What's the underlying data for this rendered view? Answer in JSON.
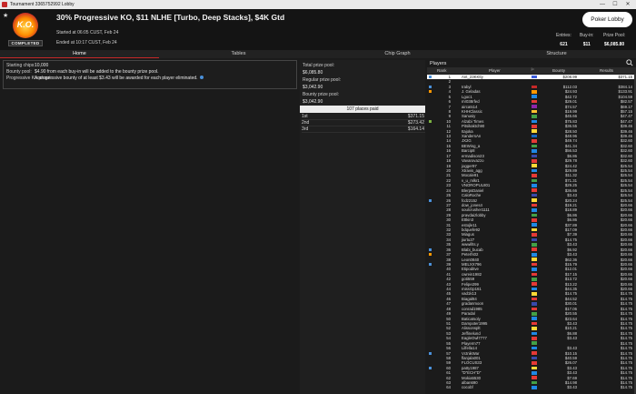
{
  "window": {
    "title": "Tournament 3365752992 Lobby",
    "controls": [
      "—",
      "☐",
      "✕"
    ]
  },
  "header": {
    "logo_text": "K.O.",
    "logo_badge": "COMPLETED",
    "tournament_name": "30% Progressive KO, $11 NLHE [Turbo, Deep Stacks], $4K Gtd",
    "started": "Started at 06:05 CUST, Feb 24",
    "ended": "Ended at 10:17 CUST, Feb 24",
    "lobby_button": "Poker Lobby",
    "entries_label": "Entries:",
    "entries_value": "621",
    "buyin_label": "Buy-in:",
    "buyin_value": "$11",
    "prizepool_label": "Prize Pool:",
    "prizepool_value": "$6,085.80"
  },
  "tabs": [
    {
      "label": "Home",
      "active": true
    },
    {
      "label": "Tables",
      "active": false
    },
    {
      "label": "Chip Graph",
      "active": false
    },
    {
      "label": "Structure",
      "active": false
    }
  ],
  "info": {
    "starting_chips_label": "Starting chips:",
    "starting_chips_value": "10,000",
    "bounty_pool_label": "Bounty pool:",
    "bounty_pool_value": "$4.90 from each buy-in will be added to the bounty prize pool.",
    "progressive_label": "Progressive Knockout:",
    "progressive_value": "A progressive bounty of at least $3.43 will be awarded for each player eliminated."
  },
  "pools": {
    "total_label": "Total prize pool:",
    "total_value": "$6,085.80",
    "regular_label": "Regular prize pool:",
    "regular_value": "$3,042.90",
    "bounty_label": "Bounty prize pool:",
    "bounty_value": "$3,042.90",
    "places_header": "107 places paid",
    "places": [
      {
        "place": "1st",
        "amount": "$371.15"
      },
      {
        "place": "2nd",
        "amount": "$273.42"
      },
      {
        "place": "3rd",
        "amount": "$164.14"
      }
    ]
  },
  "players": {
    "title": "Players",
    "columns": {
      "rank": "Rank",
      "player": "Player",
      "bounty": "Bounty",
      "results": "Results"
    },
    "rows": [
      {
        "rank": "1",
        "name": "Ant_23KKtty",
        "bounty": "$208.99",
        "result": "$371.15",
        "selected": true,
        "flag": "#3b5bdb",
        "mark": "#4a90d9"
      },
      {
        "rank": "2",
        "name": "",
        "bounty": "",
        "result": "",
        "flag": "",
        "mark": ""
      },
      {
        "rank": "3",
        "name": "Irabyl",
        "bounty": "$112.03",
        "result": "$384.14",
        "flag": "#c62828",
        "mark": "#4a90d9"
      },
      {
        "rank": "4",
        "name": "J. Geladas",
        "bounty": "$24.93",
        "result": "$133.91",
        "flag": "#ff9800",
        "mark": "#ff9800"
      },
      {
        "rank": "5",
        "name": "Lgoc1",
        "bounty": "$42.72",
        "result": "$104.59",
        "flag": "#1e88e5",
        "mark": ""
      },
      {
        "rank": "6",
        "name": "mr038rfed",
        "bounty": "$29.01",
        "result": "$82.57",
        "flag": "#e53935",
        "mark": ""
      },
      {
        "rank": "7",
        "name": "aircats14",
        "bounty": "$74.57",
        "result": "$69.17",
        "flag": "#8e24aa",
        "mark": ""
      },
      {
        "rank": "8",
        "name": "KHHClassic",
        "bounty": "$19.99",
        "result": "$57.15",
        "flag": "#fbc02d",
        "mark": ""
      },
      {
        "rank": "9",
        "name": "Sanusiy",
        "bounty": "$45.66",
        "result": "$47.47",
        "flag": "#43a047",
        "mark": ""
      },
      {
        "rank": "10",
        "name": "Alzabi Times",
        "bounty": "$75.83",
        "result": "$47.47",
        "flag": "#1e88e5",
        "mark": "#7cb342"
      },
      {
        "rank": "11",
        "name": "Pitsikaktch90",
        "bounty": "$36.55",
        "result": "$39.46",
        "flag": "#e53935",
        "mark": ""
      },
      {
        "rank": "12",
        "name": "Itajoka",
        "bounty": "$28.50",
        "result": "$39.46",
        "flag": "#fdd835",
        "mark": ""
      },
      {
        "rank": "13",
        "name": "XandersAn",
        "bounty": "$48.96",
        "result": "$39.46",
        "flag": "#1565c0",
        "mark": ""
      },
      {
        "rank": "14",
        "name": "JX2G",
        "bounty": "$49.74",
        "result": "$32.60",
        "flag": "#e53935",
        "mark": ""
      },
      {
        "rank": "15",
        "name": "BEWing_a",
        "bounty": "$41.34",
        "result": "$32.60",
        "flag": "#43a047",
        "mark": ""
      },
      {
        "rank": "16",
        "name": "Barcip8",
        "bounty": "$56.53",
        "result": "$32.60",
        "flag": "#1e88e5",
        "mark": ""
      },
      {
        "rank": "17",
        "name": "ermadison23",
        "bounty": "$6.86",
        "result": "$32.60",
        "flag": "#3949ab",
        "mark": ""
      },
      {
        "rank": "18",
        "name": "Vavarovazzo",
        "bounty": "$29.78",
        "result": "$32.60",
        "flag": "#e53935",
        "mark": ""
      },
      {
        "rank": "19",
        "name": "jogger97",
        "bounty": "$24.42",
        "result": "$25.54",
        "flag": "#fdd835",
        "mark": ""
      },
      {
        "rank": "20",
        "name": "Xtravis_agg",
        "bounty": "$29.89",
        "result": "$25.54",
        "flag": "#1e88e5",
        "mark": ""
      },
      {
        "rank": "21",
        "name": "Mocale91",
        "bounty": "$11.32",
        "result": "$25.54",
        "flag": "#e53935",
        "mark": ""
      },
      {
        "rank": "22",
        "name": "v_u_mlkr1",
        "bounty": "$71.31",
        "result": "$25.54",
        "flag": "#43a047",
        "mark": ""
      },
      {
        "rank": "23",
        "name": "VNOROPUL801",
        "bounty": "$29.25",
        "result": "$25.54",
        "flag": "#1e88e5",
        "mark": ""
      },
      {
        "rank": "24",
        "name": "BlerpsDaniel",
        "bounty": "$36.66",
        "result": "$25.54",
        "flag": "#e53935",
        "mark": ""
      },
      {
        "rank": "25",
        "name": "CaloRoche",
        "bounty": "$3.43",
        "result": "$25.54",
        "flag": "#3949ab",
        "mark": ""
      },
      {
        "rank": "26",
        "name": "fcdz215z",
        "bounty": "$20.24",
        "result": "$25.54",
        "flag": "#fdd835",
        "mark": "#4a90d9"
      },
      {
        "rank": "27",
        "name": "dow_jones4",
        "bounty": "$19.21",
        "result": "$20.66",
        "flag": "#e53935",
        "mark": ""
      },
      {
        "rank": "28",
        "name": "soulcrusher1111",
        "bounty": "$18.89",
        "result": "$20.66",
        "flag": "#1e88e5",
        "mark": ""
      },
      {
        "rank": "29",
        "name": "pravdaizlobby",
        "bounty": "$6.86",
        "result": "$20.66",
        "flag": "#43a047",
        "mark": ""
      },
      {
        "rank": "30",
        "name": "Ettkin3",
        "bounty": "$6.86",
        "result": "$20.66",
        "flag": "#e53935",
        "mark": ""
      },
      {
        "rank": "31",
        "name": "estojle11",
        "bounty": "$37.89",
        "result": "$20.66",
        "flag": "#1e88e5",
        "mark": ""
      },
      {
        "rank": "32",
        "name": "bdquefe92",
        "bounty": "$17.09",
        "result": "$20.66",
        "flag": "#fdd835",
        "mark": ""
      },
      {
        "rank": "33",
        "name": "Miagus",
        "bounty": "$7.39",
        "result": "$20.66",
        "flag": "#e53935",
        "mark": ""
      },
      {
        "rank": "34",
        "name": "jiurtu27",
        "bounty": "$14.75",
        "result": "$20.66",
        "flag": "#3949ab",
        "mark": ""
      },
      {
        "rank": "35",
        "name": "wwwillts.y",
        "bounty": "$3.43",
        "result": "$20.66",
        "flag": "#43a047",
        "mark": ""
      },
      {
        "rank": "36",
        "name": "Blabi_bucab",
        "bounty": "$6.92",
        "result": "$20.66",
        "flag": "#e53935",
        "mark": "#4a90d9"
      },
      {
        "rank": "37",
        "name": "Peterfs02",
        "bounty": "$3.43",
        "result": "$20.66",
        "flag": "#1e88e5",
        "mark": "#ff9800"
      },
      {
        "rank": "38",
        "name": "Leon0840",
        "bounty": "$62.36",
        "result": "$20.66",
        "flag": "#fdd835",
        "mark": ""
      },
      {
        "rank": "39",
        "name": "MELXX796",
        "bounty": "$15.79",
        "result": "$20.66",
        "flag": "#e53935",
        "mark": "#4a90d9"
      },
      {
        "rank": "40",
        "name": "Etipoditve",
        "bounty": "$12.01",
        "result": "$20.66",
        "flag": "#1e88e5",
        "mark": ""
      },
      {
        "rank": "41",
        "name": "cwrein1982",
        "bounty": "$17.15",
        "result": "$20.66",
        "flag": "#e53935",
        "mark": ""
      },
      {
        "rank": "42",
        "name": "goti559",
        "bounty": "$13.72",
        "result": "$20.66",
        "flag": "#43a047",
        "mark": ""
      },
      {
        "rank": "43",
        "name": "Felipe299",
        "bounty": "$13.22",
        "result": "$20.66",
        "flag": "#e53935",
        "mark": ""
      },
      {
        "rank": "44",
        "name": "missGp161",
        "bounty": "$44.35",
        "result": "$20.66",
        "flag": "#1e88e5",
        "mark": ""
      },
      {
        "rank": "45",
        "name": "vad1k13",
        "bounty": "$14.75",
        "result": "$14.75",
        "flag": "#fdd835",
        "mark": ""
      },
      {
        "rank": "46",
        "name": "Biagal84",
        "bounty": "$44.52",
        "result": "$14.75",
        "flag": "#e53935",
        "mark": ""
      },
      {
        "rank": "47",
        "name": "gradanmoon",
        "bounty": "$30.01",
        "result": "$14.75",
        "flag": "#3949ab",
        "mark": ""
      },
      {
        "rank": "48",
        "name": "conrad1985",
        "bounty": "$17.06",
        "result": "$14.75",
        "flag": "#e53935",
        "mark": ""
      },
      {
        "rank": "49",
        "name": "Paradal",
        "bounty": "$20.55",
        "result": "$14.75",
        "flag": "#43a047",
        "mark": ""
      },
      {
        "rank": "50",
        "name": "Baticatsoly",
        "bounty": "$23.64",
        "result": "$14.75",
        "flag": "#1e88e5",
        "mark": ""
      },
      {
        "rank": "51",
        "name": "Dampoter1995",
        "bounty": "$3.43",
        "result": "$14.75",
        "flag": "#e53935",
        "mark": ""
      },
      {
        "rank": "52",
        "name": "Alissonsplt",
        "bounty": "$10.21",
        "result": "$14.75",
        "flag": "#fdd835",
        "mark": ""
      },
      {
        "rank": "53",
        "name": "Jeffinelund",
        "bounty": "$6.88",
        "result": "$14.75",
        "flag": "#1e88e5",
        "mark": ""
      },
      {
        "rank": "54",
        "name": "EagleOwl7777",
        "bounty": "$3.43",
        "result": "$14.75",
        "flag": "#e53935",
        "mark": ""
      },
      {
        "rank": "55",
        "name": "Playerm77",
        "bounty": "",
        "result": "$14.75",
        "flag": "#43a047",
        "mark": ""
      },
      {
        "rank": "56",
        "name": "Lilfella14",
        "bounty": "$3.43",
        "result": "$14.75",
        "flag": "#1e88e5",
        "mark": ""
      },
      {
        "rank": "57",
        "name": "VctnikWar",
        "bounty": "$10.15",
        "result": "$14.75",
        "flag": "#e53935",
        "mark": "#4a90d9"
      },
      {
        "rank": "58",
        "name": "flanjala001",
        "bounty": "$40.59",
        "result": "$14.75",
        "flag": "#3949ab",
        "mark": ""
      },
      {
        "rank": "59",
        "name": "FLOCUS33",
        "bounty": "$26.07",
        "result": "$14.75",
        "flag": "#e53935",
        "mark": ""
      },
      {
        "rank": "60",
        "name": "patty1987",
        "bounty": "$3.43",
        "result": "$14.75",
        "flag": "#fdd835",
        "mark": "#4a90d9"
      },
      {
        "rank": "61",
        "name": "\"D\"ECH\"D\"",
        "bounty": "$3.43",
        "result": "$14.75",
        "flag": "#1e88e5",
        "mark": ""
      },
      {
        "rank": "62",
        "name": "Mokia5530",
        "bounty": "$7.69",
        "result": "$14.75",
        "flag": "#e53935",
        "mark": ""
      },
      {
        "rank": "63",
        "name": "alban690",
        "bounty": "$14.98",
        "result": "$14.75",
        "flag": "#43a047",
        "mark": ""
      },
      {
        "rank": "64",
        "name": "cocobf",
        "bounty": "$3.43",
        "result": "$14.75",
        "flag": "#1e88e5",
        "mark": ""
      }
    ]
  }
}
